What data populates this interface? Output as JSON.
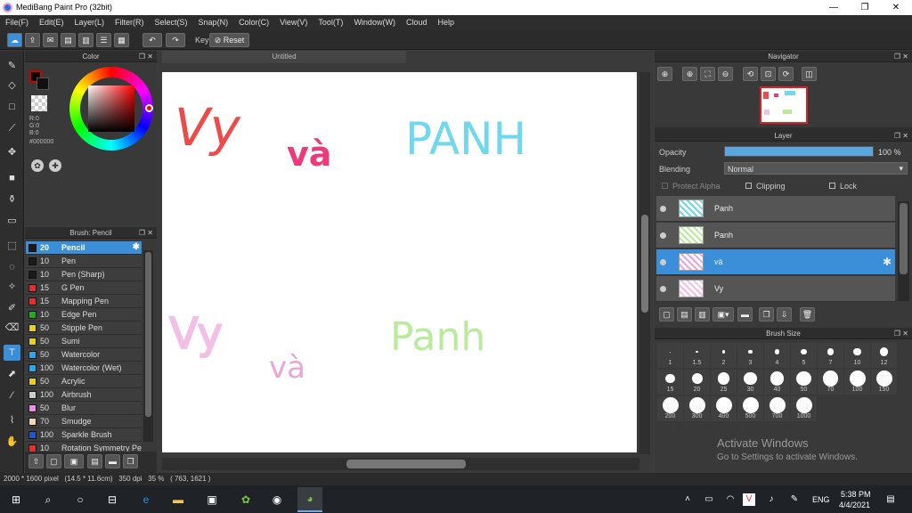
{
  "window": {
    "title": "MediBang Paint Pro (32bit)",
    "min": "—",
    "restore": "❐",
    "close": "✕"
  },
  "menu": [
    "File(F)",
    "Edit(E)",
    "Layer(L)",
    "Filter(R)",
    "Select(S)",
    "Snap(N)",
    "Color(C)",
    "View(V)",
    "Tool(T)",
    "Window(W)",
    "Cloud",
    "Help"
  ],
  "toolbar": {
    "key_label": "Key",
    "reset_label": "Reset"
  },
  "color_panel": {
    "title": "Color",
    "r": "R:0",
    "g": "G:0",
    "b": "B:0",
    "hex": "#000000",
    "accent": "#cc0000"
  },
  "brush_panel": {
    "title": "Brush: Pencil",
    "brushes": [
      {
        "size": "20",
        "name": "Pencil",
        "color": "#1a1a1a"
      },
      {
        "size": "10",
        "name": "Pen",
        "color": "#1a1a1a"
      },
      {
        "size": "10",
        "name": "Pen (Sharp)",
        "color": "#1a1a1a"
      },
      {
        "size": "15",
        "name": "G Pen",
        "color": "#e03030"
      },
      {
        "size": "15",
        "name": "Mapping Pen",
        "color": "#e03030"
      },
      {
        "size": "10",
        "name": "Edge Pen",
        "color": "#22aa22"
      },
      {
        "size": "50",
        "name": "Stipple Pen",
        "color": "#e8d020"
      },
      {
        "size": "50",
        "name": "Sumi",
        "color": "#e8d020"
      },
      {
        "size": "50",
        "name": "Watercolor",
        "color": "#2aa8e8"
      },
      {
        "size": "100",
        "name": "Watercolor (Wet)",
        "color": "#2aa8e8"
      },
      {
        "size": "50",
        "name": "Acrylic",
        "color": "#e8d020"
      },
      {
        "size": "100",
        "name": "Airbrush",
        "color": "#cccccc"
      },
      {
        "size": "50",
        "name": "Blur",
        "color": "#e890e8"
      },
      {
        "size": "70",
        "name": "Smudge",
        "color": "#f0d8b8"
      },
      {
        "size": "100",
        "name": "Sparkle Brush",
        "color": "#2255cc"
      },
      {
        "size": "10",
        "name": "Rotation Symmetry Pe",
        "color": "#e03030"
      }
    ]
  },
  "canvas": {
    "tab_title": "Untitled",
    "texts": [
      {
        "text": "Vy",
        "color": "#ee4a4a"
      },
      {
        "text": "và",
        "color": "#ee3a7a"
      },
      {
        "text": "PANH",
        "color": "#6fd8ec"
      },
      {
        "text": "Vy",
        "color": "#f2c0e6"
      },
      {
        "text": "và",
        "color": "#eaa6d8"
      },
      {
        "text": "Panh",
        "color": "#b8ec9c"
      }
    ]
  },
  "navigator": {
    "title": "Navigator"
  },
  "layer_panel": {
    "title": "Layer",
    "opacity_label": "Opacity",
    "opacity_value": "100 %",
    "opacity_fill": 1.0,
    "blending_label": "Blending",
    "blending_value": "Normal",
    "protect_alpha": "Protect Alpha",
    "clipping": "Clipping",
    "lock": "Lock",
    "layers": [
      {
        "name": "Panh",
        "selected": false
      },
      {
        "name": "Panh",
        "selected": false
      },
      {
        "name": "và",
        "selected": true
      },
      {
        "name": "Vy",
        "selected": false
      }
    ]
  },
  "brush_size_panel": {
    "title": "Brush Size",
    "sizes": [
      "1",
      "1.5",
      "2",
      "3",
      "4",
      "5",
      "7",
      "10",
      "12",
      "15",
      "20",
      "25",
      "30",
      "40",
      "50",
      "70",
      "100",
      "150",
      "200",
      "300",
      "400",
      "500",
      "700",
      "1000"
    ]
  },
  "watermark": {
    "line1": "Activate Windows",
    "line2": "Go to Settings to activate Windows."
  },
  "status": {
    "text": "2000 * 1600 pixel   (14.5 * 11.6cm)   350 dpi   35 %   ( 763, 1621 )"
  },
  "taskbar": {
    "lang": "ENG",
    "time": "5:38 PM",
    "date": "4/4/2021"
  }
}
